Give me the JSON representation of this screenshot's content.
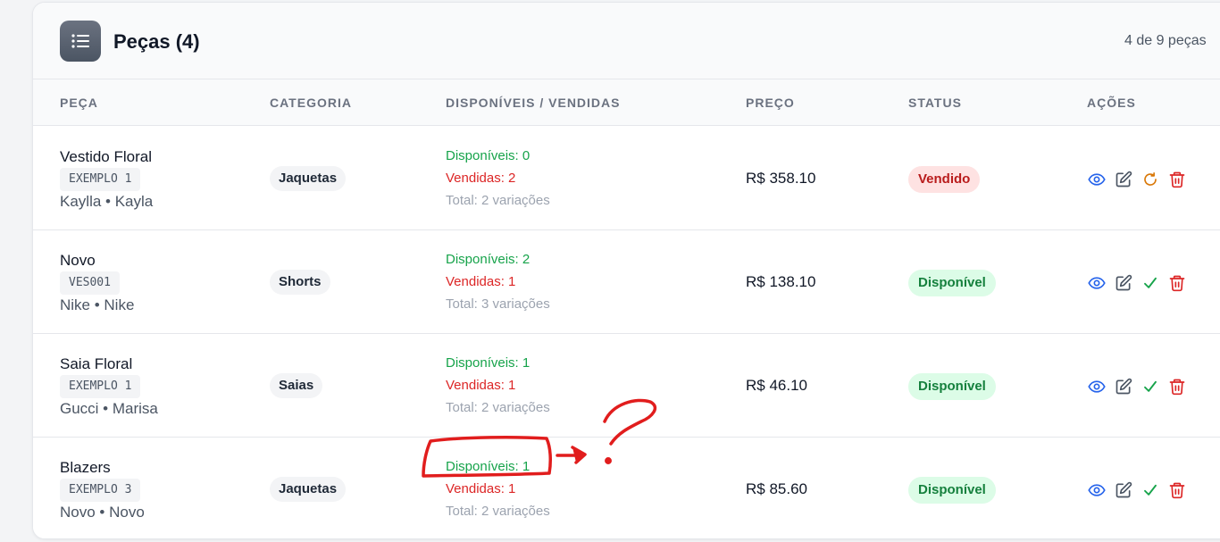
{
  "header": {
    "title": "Peças (4)",
    "count_text": "4 de 9 peças",
    "icon": "list-icon"
  },
  "columns": {
    "piece": "PEÇA",
    "category": "CATEGORIA",
    "availability": "DISPONÍVEIS / VENDIDAS",
    "price": "PREÇO",
    "status": "STATUS",
    "actions": "AÇÕES"
  },
  "rows": [
    {
      "name": "Vestido Floral",
      "code": "EXEMPLO 1",
      "brand": "Kaylla • Kayla",
      "category": "Jaquetas",
      "available": "Disponíveis: 0",
      "sold": "Vendidas: 2",
      "total": "Total: 2 variações",
      "price": "R$ 358.10",
      "status": "Vendido",
      "status_type": "sold",
      "action_icons": [
        "eye-icon",
        "edit-icon",
        "refresh-icon",
        "trash-icon"
      ]
    },
    {
      "name": "Novo",
      "code": "VES001",
      "brand": "Nike • Nike",
      "category": "Shorts",
      "available": "Disponíveis: 2",
      "sold": "Vendidas: 1",
      "total": "Total: 3 variações",
      "price": "R$ 138.10",
      "status": "Disponível",
      "status_type": "available",
      "action_icons": [
        "eye-icon",
        "edit-icon",
        "check-icon",
        "trash-icon"
      ]
    },
    {
      "name": "Saia Floral",
      "code": "EXEMPLO 1",
      "brand": "Gucci • Marisa",
      "category": "Saias",
      "available": "Disponíveis: 1",
      "sold": "Vendidas: 1",
      "total": "Total: 2 variações",
      "price": "R$ 46.10",
      "status": "Disponível",
      "status_type": "available",
      "action_icons": [
        "eye-icon",
        "edit-icon",
        "check-icon",
        "trash-icon"
      ]
    },
    {
      "name": "Blazers",
      "code": "EXEMPLO 3",
      "brand": "Novo • Novo",
      "category": "Jaquetas",
      "available": "Disponíveis: 1",
      "sold": "Vendidas: 1",
      "total": "Total: 2 variações",
      "price": "R$ 85.60",
      "status": "Disponível",
      "status_type": "available",
      "action_icons": [
        "eye-icon",
        "edit-icon",
        "check-icon",
        "trash-icon"
      ]
    }
  ],
  "colors": {
    "available_text": "#16a34a",
    "sold_text": "#dc2626",
    "muted_text": "#9ca3af",
    "eye_icon": "#2563eb",
    "edit_icon": "#4b5563",
    "refresh_icon": "#d97706",
    "check_icon": "#16a34a",
    "trash_icon": "#dc2626",
    "annotation": "#e11d1d"
  }
}
